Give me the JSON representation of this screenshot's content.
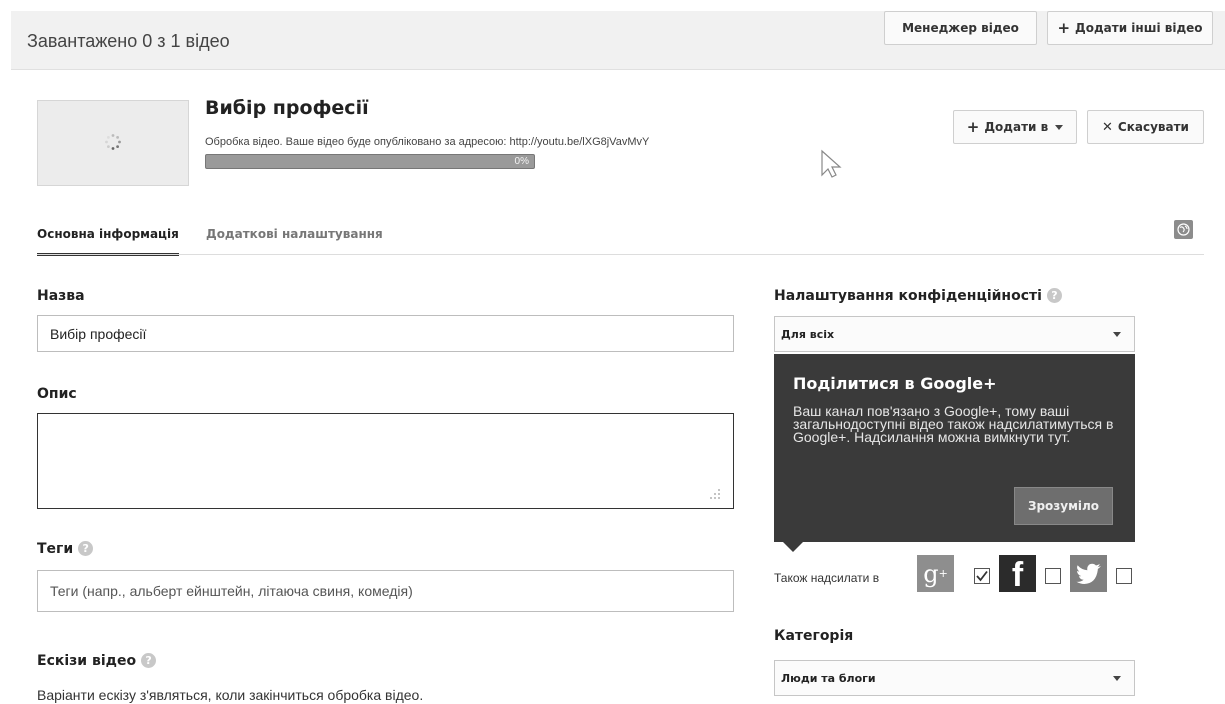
{
  "header": {
    "upload_status": "Завантажено 0 з 1 відео",
    "video_manager_label": "Менеджер відео",
    "add_more_videos_label": "Додати інші відео"
  },
  "video": {
    "title": "Вибір професії",
    "processing_text": "Обробка відео. Ваше відео буде опубліковано за адресою: http://youtu.be/lXG8jVavMvY",
    "progress_label": "0%",
    "progress_fraction": 0
  },
  "actions": {
    "add_to_label": "Додати в",
    "cancel_label": "Скасувати"
  },
  "tabs": [
    {
      "label": "Основна інформація",
      "active": true
    },
    {
      "label": "Додаткові налаштування",
      "active": false
    }
  ],
  "form": {
    "title_label": "Назва",
    "title_value": "Вибір професії",
    "description_label": "Опис",
    "description_value": "",
    "tags_label": "Теги",
    "tags_placeholder": "Теги (напр., альберт ейнштейн, літаюча свиня, комедія)",
    "thumbnails_label": "Ескізи відео",
    "thumbnails_note": "Варіанти ескізу з'являться, коли закінчиться обробка відео."
  },
  "privacy": {
    "label": "Налаштування конфіденційності",
    "selected": "Для всіх"
  },
  "gplus_tooltip": {
    "title": "Поділитися в Google+",
    "body": "Ваш канал пов'язано з Google+, тому ваші загальнодоступні відео також надсилатимуться в Google+. Надсилання можна вимкнути тут.",
    "button_label": "Зрозуміло"
  },
  "also_share": {
    "label": "Також надсилати в",
    "services": [
      {
        "name": "google-plus",
        "checked": true
      },
      {
        "name": "facebook",
        "checked": false
      },
      {
        "name": "twitter",
        "checked": false
      }
    ]
  },
  "category": {
    "label": "Категорія",
    "selected": "Люди та блоги"
  },
  "help_icon_glyph": "?",
  "colors": {
    "tooltip_bg": "#3a3a3a",
    "topbar_bg": "#f1f1f1"
  }
}
